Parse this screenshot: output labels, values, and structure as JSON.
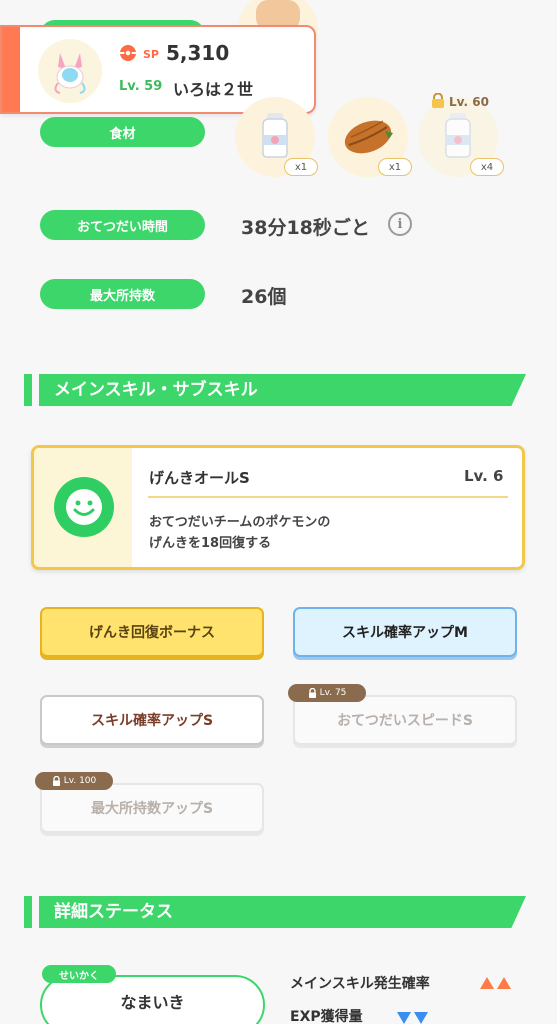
{
  "pokemon": {
    "sp_label": "SP",
    "sp_value": "5,310",
    "level": "Lv. 59",
    "name": "いろは２世"
  },
  "rows": {
    "ingredients": {
      "label": "食材",
      "items": [
        {
          "count": "x1"
        },
        {
          "count": "x1"
        },
        {
          "count": "x4",
          "lock_level": "Lv. 60"
        }
      ]
    },
    "help_time": {
      "label": "おてつだい時間",
      "value": "38分18秒ごと"
    },
    "max_carry": {
      "label": "最大所持数",
      "value": "26個"
    }
  },
  "skills_section": {
    "title": "メインスキル・サブスキル"
  },
  "main_skill": {
    "name": "げんきオールS",
    "level": "Lv. 6",
    "desc_line1": "おてつだいチームのポケモンの",
    "desc_line2": "げんきを18回復する"
  },
  "sub_skills": [
    {
      "label": "げんき回復ボーナス",
      "style": "gold"
    },
    {
      "label": "スキル確率アップM",
      "style": "blue"
    },
    {
      "label": "スキル確率アップS",
      "style": "white"
    },
    {
      "label": "おてつだいスピードS",
      "style": "locked",
      "lock_level": "Lv. 75"
    },
    {
      "label": "最大所持数アップS",
      "style": "locked",
      "lock_level": "Lv. 100"
    }
  ],
  "detail_section": {
    "title": "詳細ステータス"
  },
  "nature": {
    "tag": "せいかく",
    "value": "なまいき"
  },
  "stats": [
    {
      "label": "メインスキル発生確率",
      "arrow": "up",
      "arrow_color": "#ff7a45"
    },
    {
      "label": "EXP獲得量",
      "arrow": "down",
      "arrow_color": "#3a8ef0"
    }
  ],
  "colors": {
    "green": "#3dd66b",
    "orange": "#ff7a52",
    "gold": "#f3c84a"
  },
  "icons": [
    "pokeball-icon",
    "lock-icon",
    "info-icon",
    "smile-icon",
    "milk-icon",
    "cacao-icon"
  ]
}
